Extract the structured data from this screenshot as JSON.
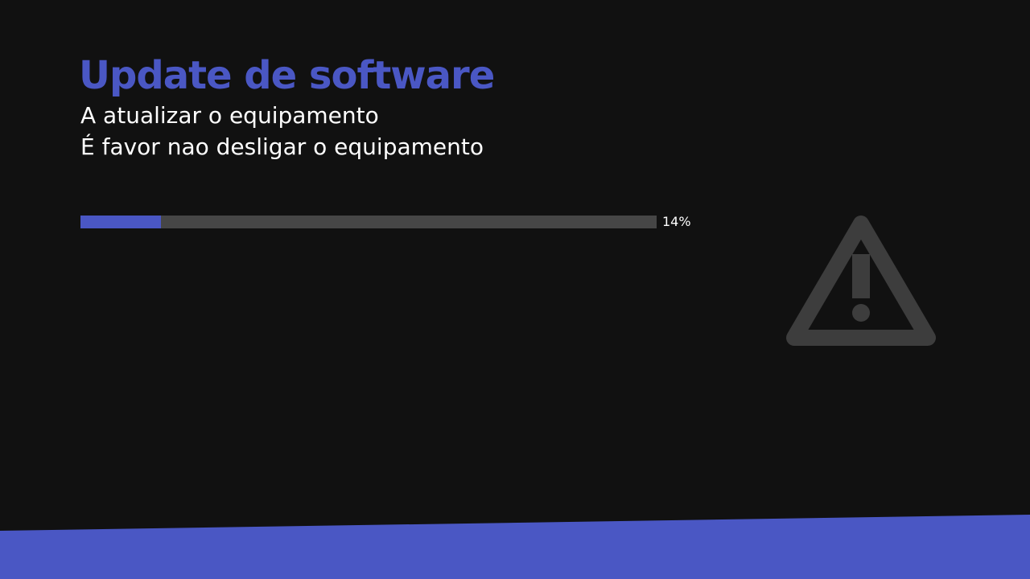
{
  "screen": {
    "title": "Update de software",
    "message_line1": "A atualizar o equipamento",
    "message_line2": "É favor nao desligar o equipamento"
  },
  "progress": {
    "percent": 14,
    "label": "14%"
  },
  "icons": {
    "warning": "warning-triangle-icon"
  },
  "colors": {
    "background": "#111111",
    "accent": "#4a57c4",
    "track": "#464646",
    "icon": "#3d3d3d",
    "text": "#ffffff"
  }
}
